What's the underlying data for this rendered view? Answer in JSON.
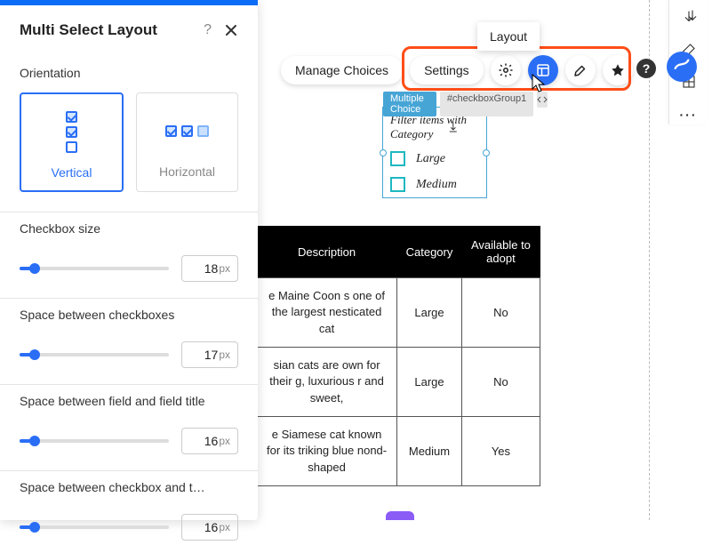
{
  "panel": {
    "title": "Multi Select Layout",
    "orientation_label": "Orientation",
    "vertical_label": "Vertical",
    "horizontal_label": "Horizontal",
    "sliders": [
      {
        "label": "Checkbox size",
        "value": "18",
        "unit": "px"
      },
      {
        "label": "Space between checkboxes",
        "value": "17",
        "unit": "px"
      },
      {
        "label": "Space between field and field title",
        "value": "16",
        "unit": "px"
      },
      {
        "label": "Space between checkbox and t…",
        "value": "16",
        "unit": "px"
      }
    ]
  },
  "toolbar": {
    "manage_choices": "Manage Choices",
    "settings": "Settings",
    "tooltip": "Layout",
    "help_glyph": "?"
  },
  "widget": {
    "tag_blue": "Multiple Choice",
    "tag_gray": "#checkboxGroup1",
    "title": "Filter items with Category",
    "items": [
      "Large",
      "Medium"
    ]
  },
  "table": {
    "headers": [
      "Description",
      "Category",
      "Available to adopt"
    ],
    "rows": [
      {
        "desc": "e Maine Coon s one of the largest nesticated cat",
        "cat": "Large",
        "avail": "No"
      },
      {
        "desc": "sian cats are own for their g, luxurious r and sweet,",
        "cat": "Large",
        "avail": "No"
      },
      {
        "desc": "e Siamese cat known for its triking blue nond-shaped",
        "cat": "Medium",
        "avail": "Yes"
      }
    ]
  },
  "colors": {
    "accent": "#2a6ef5",
    "teal": "#1eb8c1",
    "highlight": "#ff4d17"
  }
}
